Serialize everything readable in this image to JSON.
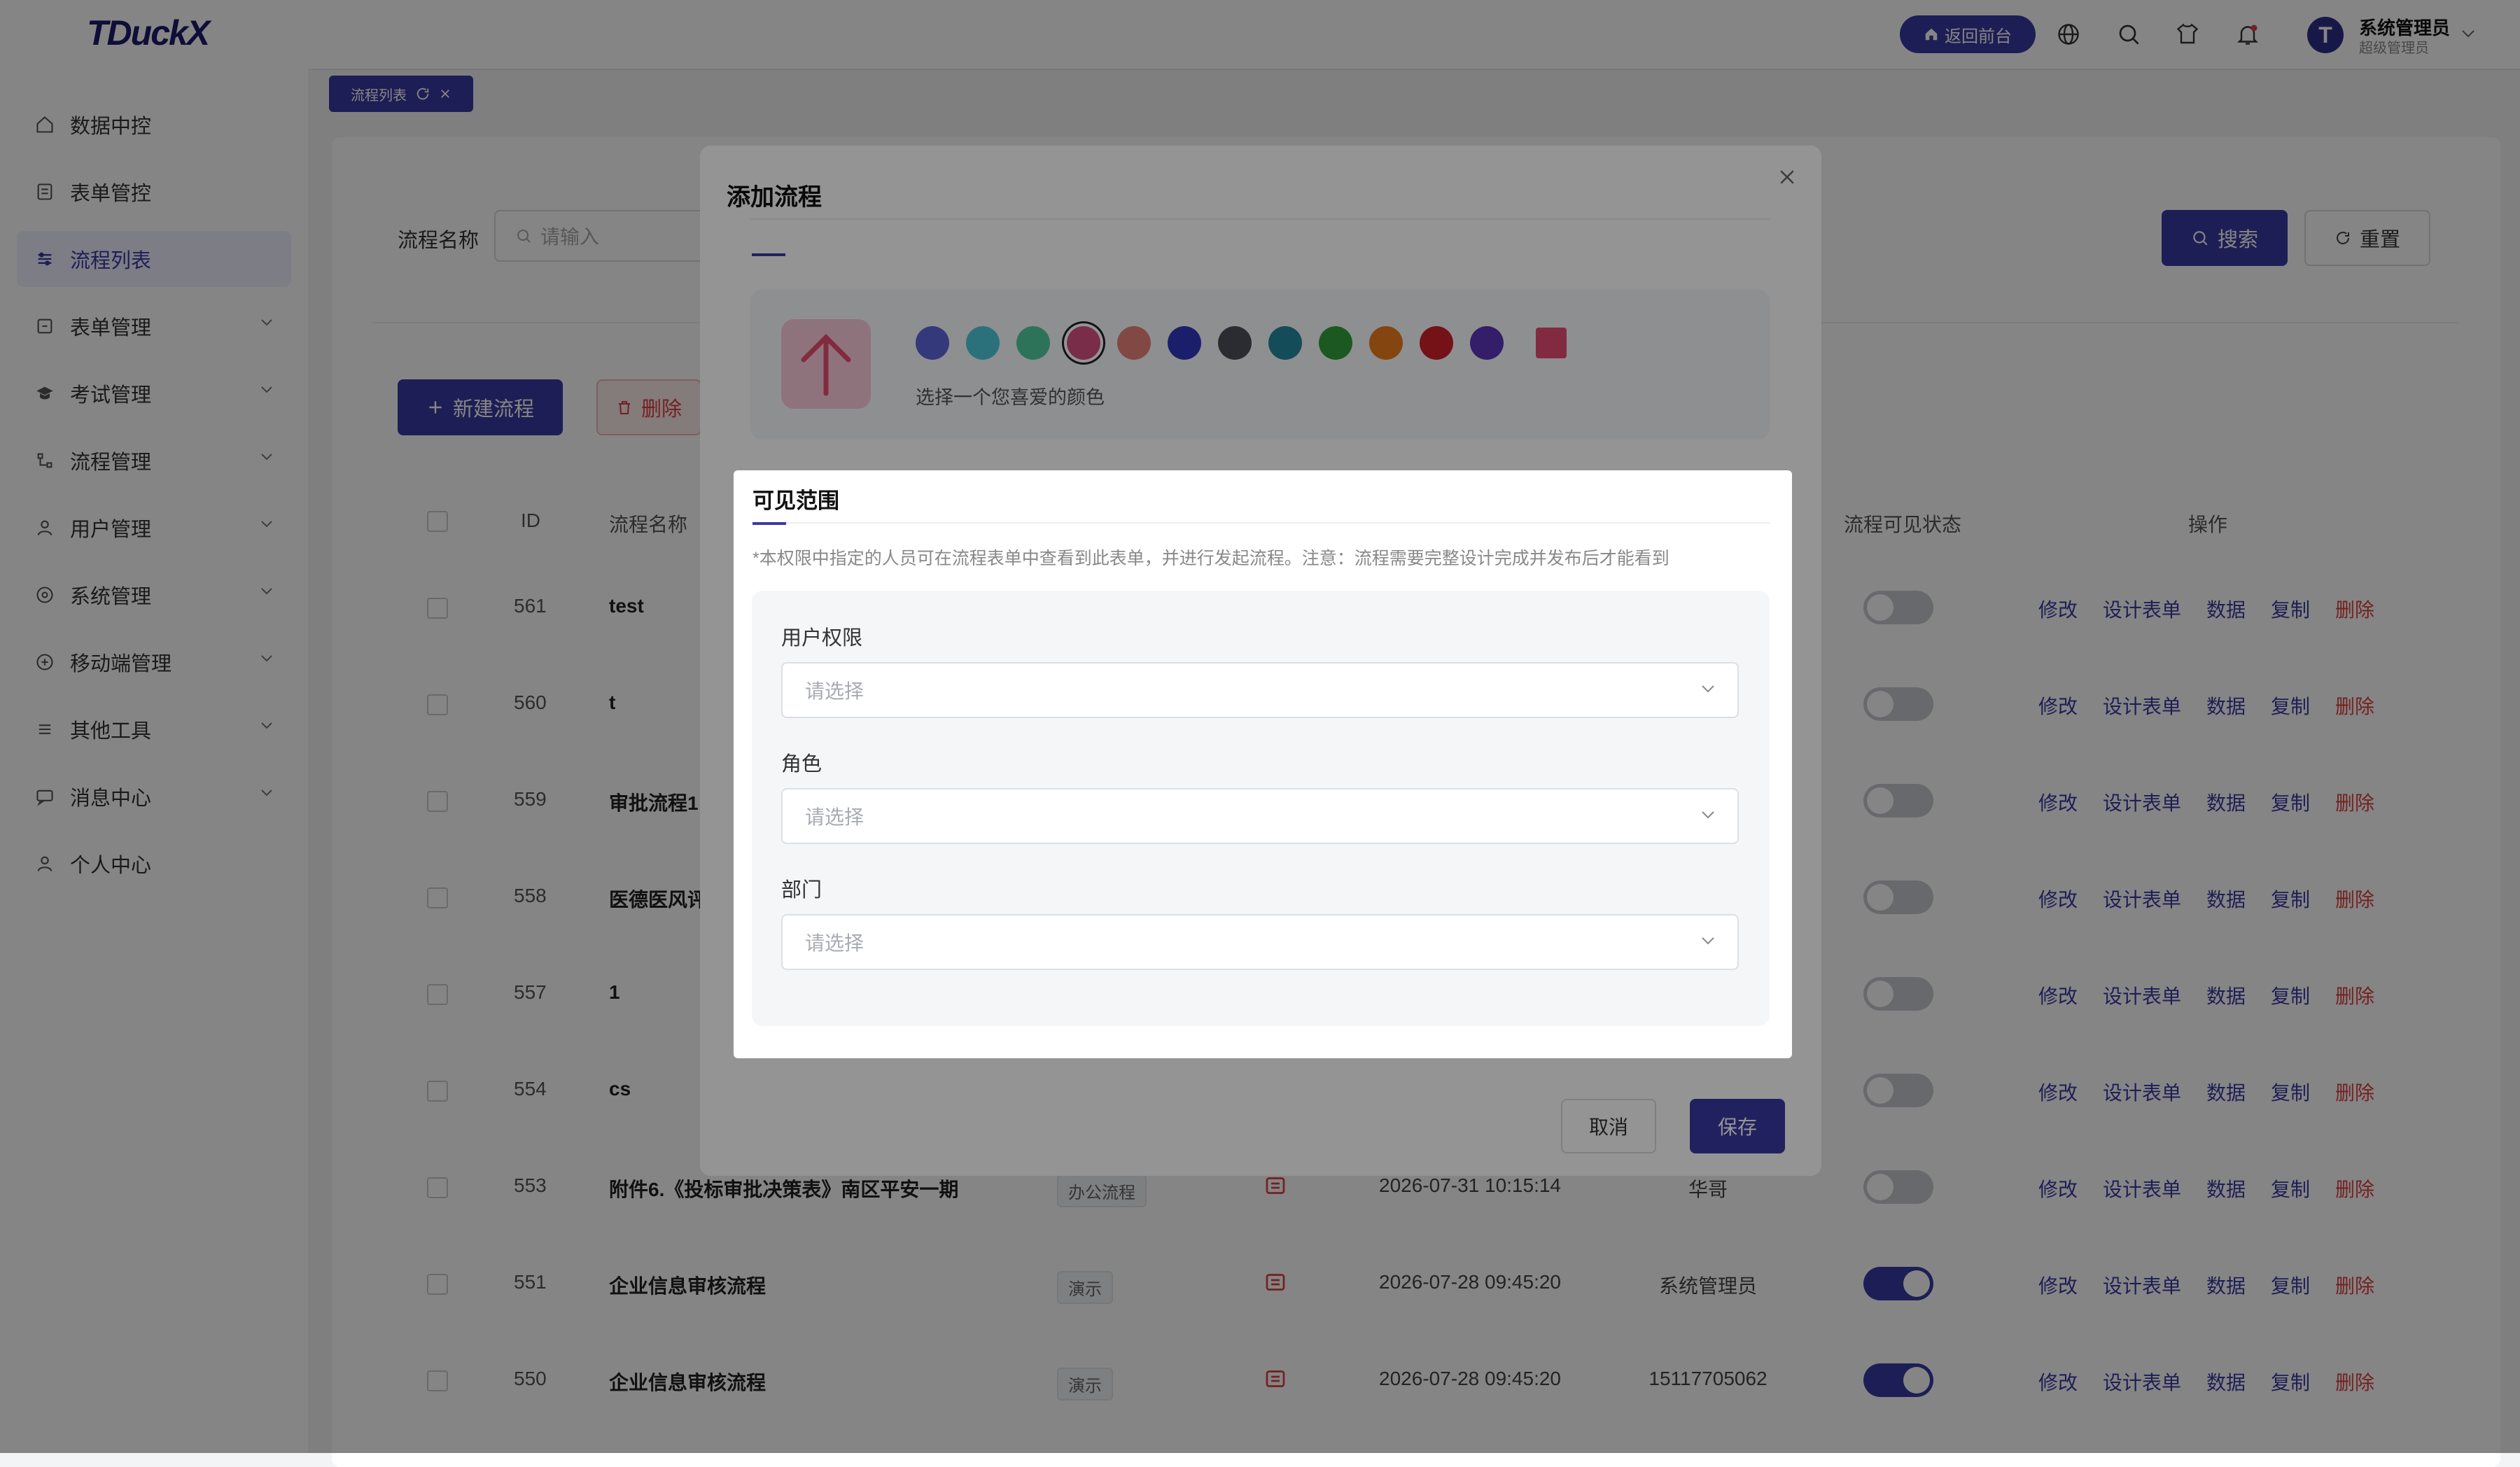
{
  "app": {
    "logo": "TDuckX",
    "back_label": "返回前台",
    "user_name": "系统管理员",
    "user_role": "超级管理员",
    "avatar_letter": "T"
  },
  "sidebar": {
    "items": [
      {
        "label": "数据中控",
        "icon": "home-icon"
      },
      {
        "label": "表单管控",
        "icon": "form-icon"
      },
      {
        "label": "流程列表",
        "icon": "flow-list-icon"
      },
      {
        "label": "表单管理",
        "icon": "form-manage-icon"
      },
      {
        "label": "考试管理",
        "icon": "exam-icon"
      },
      {
        "label": "流程管理",
        "icon": "flow-manage-icon"
      },
      {
        "label": "用户管理",
        "icon": "user-icon"
      },
      {
        "label": "系统管理",
        "icon": "system-icon"
      },
      {
        "label": "移动端管理",
        "icon": "mobile-icon"
      },
      {
        "label": "其他工具",
        "icon": "tools-icon"
      },
      {
        "label": "消息中心",
        "icon": "message-icon"
      },
      {
        "label": "个人中心",
        "icon": "profile-icon"
      }
    ]
  },
  "tab": {
    "label": "流程列表"
  },
  "filter": {
    "label": "流程名称",
    "placeholder": "请输入",
    "search_label": "搜索",
    "reset_label": "重置"
  },
  "toolbar": {
    "new_label": "新建流程",
    "delete_label": "删除"
  },
  "table": {
    "headers": {
      "id": "ID",
      "name": "流程名称",
      "visible_status": "流程可见状态",
      "actions": "操作"
    },
    "action_labels": {
      "edit": "修改",
      "design": "设计表单",
      "data": "数据",
      "copy": "复制",
      "delete": "删除"
    },
    "rows": [
      {
        "id": "561",
        "name": "test",
        "tag": "",
        "time": "",
        "owner": "",
        "enabled": false
      },
      {
        "id": "560",
        "name": "t",
        "tag": "",
        "time": "",
        "owner": "",
        "enabled": false
      },
      {
        "id": "559",
        "name": "审批流程1",
        "tag": "",
        "time": "",
        "owner": "",
        "enabled": false
      },
      {
        "id": "558",
        "name": "医德医风评",
        "tag": "",
        "time": "",
        "owner": "",
        "enabled": false
      },
      {
        "id": "557",
        "name": "1",
        "tag": "",
        "time": "",
        "owner": "",
        "enabled": false
      },
      {
        "id": "554",
        "name": "cs",
        "tag": "",
        "time": "",
        "owner": "",
        "enabled": false
      },
      {
        "id": "553",
        "name": "附件6.《投标审批决策表》南区平安一期",
        "tag": "办公流程",
        "time": "2026-07-31 10:15:14",
        "owner": "华哥",
        "enabled": false
      },
      {
        "id": "551",
        "name": "企业信息审核流程",
        "tag": "演示",
        "time": "2026-07-28 09:45:20",
        "owner": "系统管理员",
        "enabled": true
      },
      {
        "id": "550",
        "name": "企业信息审核流程",
        "tag": "演示",
        "time": "2026-07-28 09:45:20",
        "owner": "15117705062",
        "enabled": true
      }
    ]
  },
  "dialog": {
    "title": "添加流程",
    "color_hint": "选择一个您喜爱的颜色",
    "colors": [
      "#5a63d6",
      "#4ac3d6",
      "#4fc79a",
      "#d14f7f",
      "#e07c76",
      "#2f36b8",
      "#4b4d55",
      "#23849a",
      "#2f9a3a",
      "#e3781c",
      "#c8202a",
      "#5a32b5",
      "#e04b6f"
    ],
    "selected_color": "#d14f7f",
    "cancel_label": "取消",
    "save_label": "保存"
  },
  "visibility": {
    "title": "可见范围",
    "note": "*本权限中指定的人员可在流程表单中查看到此表单，并进行发起流程。注意：流程需要完整设计完成并发布后才能看到",
    "fields": [
      {
        "label": "用户权限",
        "placeholder": "请选择"
      },
      {
        "label": "角色",
        "placeholder": "请选择"
      },
      {
        "label": "部门",
        "placeholder": "请选择"
      }
    ]
  }
}
